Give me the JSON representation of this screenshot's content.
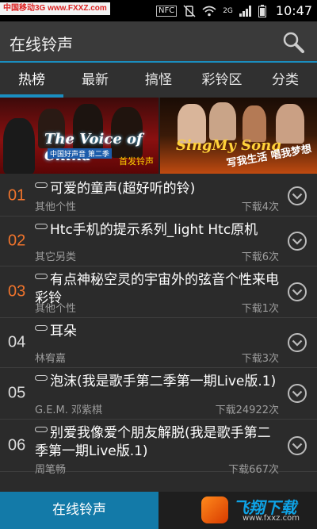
{
  "watermark": {
    "text": "中国移动3G",
    "site": "www.FXXZ.com"
  },
  "status": {
    "nfc": "NFC",
    "network": "2G",
    "time": "10:47"
  },
  "header": {
    "title": "在线铃声"
  },
  "tabs": [
    {
      "label": "热榜",
      "active": true
    },
    {
      "label": "最新",
      "active": false
    },
    {
      "label": "搞怪",
      "active": false
    },
    {
      "label": "彩铃区",
      "active": false
    },
    {
      "label": "分类",
      "active": false
    }
  ],
  "banners": {
    "left": {
      "logo": "The Voice of China",
      "subtitle": "中国好声音 第二季",
      "tag": "首发铃声"
    },
    "right": {
      "logo": "SingMy Song",
      "slogan": "写我生活 唱我梦想"
    }
  },
  "songs": [
    {
      "rank": "01",
      "title": "可爱的童声(超好听的铃)",
      "artist": "其他个性",
      "downloads": "下载4次"
    },
    {
      "rank": "02",
      "title": "Htc手机的提示系列_light Htc原机",
      "artist": "其它另类",
      "downloads": "下载6次"
    },
    {
      "rank": "03",
      "title": "有点神秘空灵的宇宙外的弦音个性来电彩铃",
      "artist": "其他个性",
      "downloads": "下载1次"
    },
    {
      "rank": "04",
      "title": "耳朵",
      "artist": "林宥嘉",
      "downloads": "下载3次"
    },
    {
      "rank": "05",
      "title": "泡沫(我是歌手第二季第一期Live版.1)",
      "artist": "G.E.M. 邓紫棋",
      "downloads": "下载24922次"
    },
    {
      "rank": "06",
      "title": "别爱我像爱个朋友解脱(我是歌手第二季第一期Live版.1)",
      "artist": "周笔畅",
      "downloads": "下载667次"
    }
  ],
  "bottom": {
    "tab_label": "在线铃声",
    "logo_name": "飞翔下载",
    "logo_url": "www.fxxz.com"
  },
  "colors": {
    "accent": "#1a8ec0",
    "hot_rank": "#f0742c",
    "background": "#2b2b2b"
  }
}
